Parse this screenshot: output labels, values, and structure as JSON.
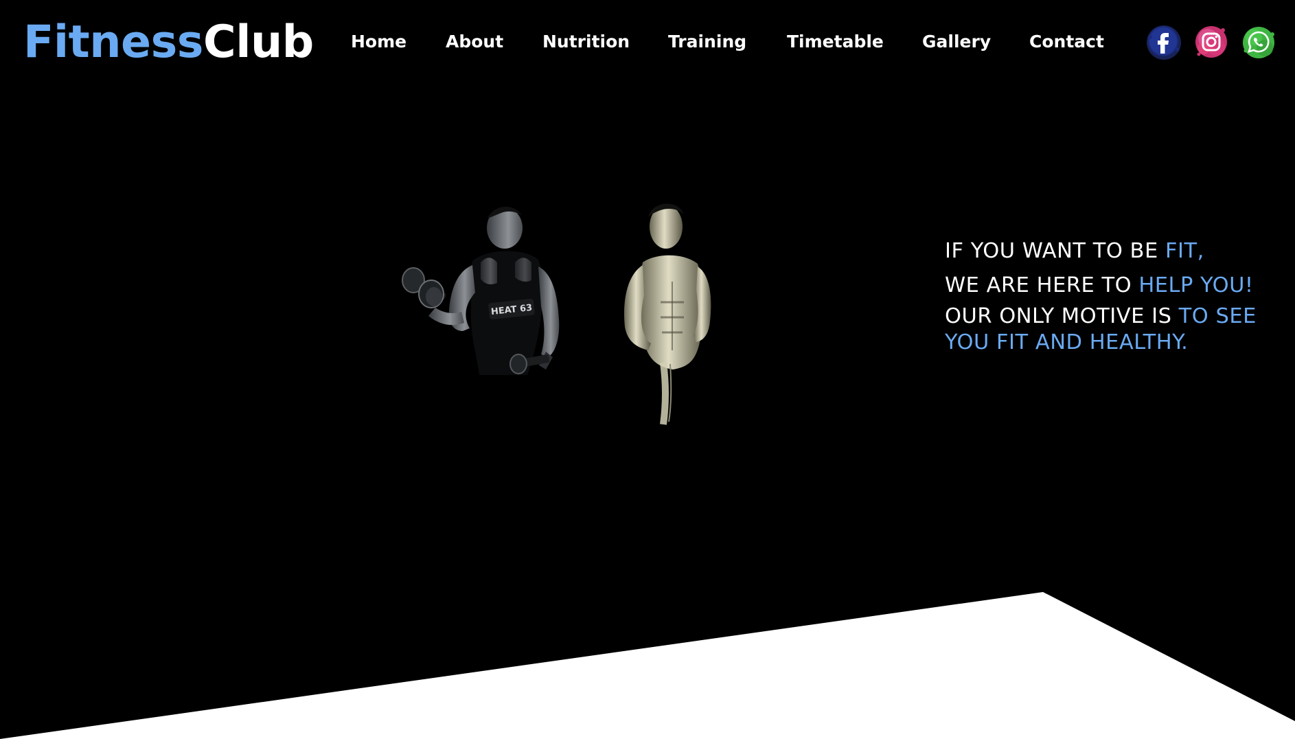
{
  "brand": {
    "part1": "Fitness",
    "part2": "Club"
  },
  "nav": {
    "items": [
      {
        "label": "Home"
      },
      {
        "label": "About"
      },
      {
        "label": "Nutrition"
      },
      {
        "label": "Training"
      },
      {
        "label": "Timetable"
      },
      {
        "label": "Gallery"
      },
      {
        "label": "Contact"
      }
    ]
  },
  "social": [
    {
      "icon": "facebook-icon",
      "color": "#1b2a7a"
    },
    {
      "icon": "instagram-icon",
      "color": "#d8377a"
    },
    {
      "icon": "whatsapp-icon",
      "color": "#3fb543"
    }
  ],
  "hero": {
    "line1_white": "IF YOU WANT TO BE ",
    "line1_accent": "FIT,",
    "line2_white": "WE ARE HERE TO ",
    "line2_accent": "HELP YOU!",
    "line3_white": "OUR ONLY MOTIVE IS ",
    "line3_accent": "TO SEE YOU FIT AND HEALTHY.",
    "vest_text": "HEAT 63"
  },
  "colors": {
    "accent": "#6aaaf2",
    "background": "#000000",
    "text": "#ffffff"
  }
}
